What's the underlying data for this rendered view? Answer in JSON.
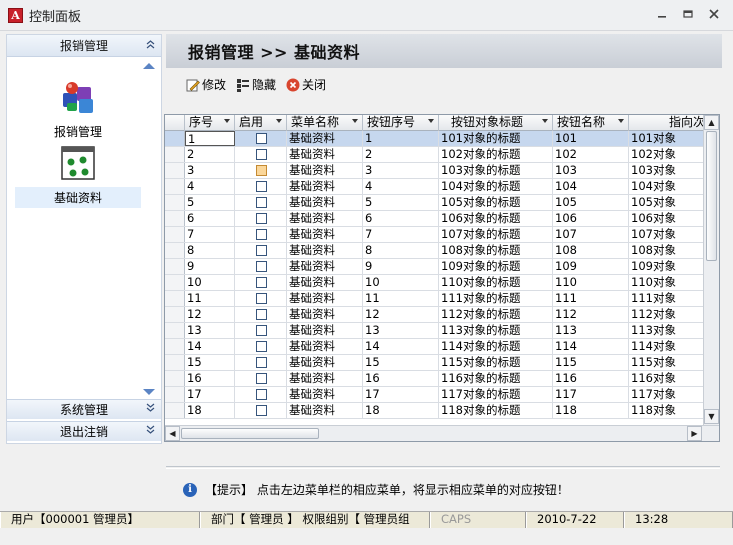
{
  "window": {
    "title": "控制面板",
    "app_icon_letter": "A"
  },
  "sidebar": {
    "header": "报销管理",
    "items": [
      {
        "label": "报销管理",
        "icon": "puzzle-blocks-icon"
      },
      {
        "label": "基础资料",
        "icon": "grid-dots-window-icon"
      }
    ],
    "footers": [
      {
        "label": "系统管理"
      },
      {
        "label": "退出注销"
      }
    ]
  },
  "header": {
    "breadcrumb": "报销管理 >> 基础资料"
  },
  "toolbar": {
    "edit_label": "修改",
    "hide_label": "隐藏",
    "close_label": "关闭"
  },
  "grid": {
    "columns": [
      "序号",
      "启用",
      "菜单名称",
      "按钮序号",
      "按钮对象标题",
      "按钮名称",
      "指向次"
    ],
    "rows": [
      {
        "seq": "1",
        "menu": "基础资料",
        "btn_no": "1",
        "title": "101对象的标题",
        "name": "101",
        "target": "101对象"
      },
      {
        "seq": "2",
        "menu": "基础资料",
        "btn_no": "2",
        "title": "102对象的标题",
        "name": "102",
        "target": "102对象"
      },
      {
        "seq": "3",
        "menu": "基础资料",
        "btn_no": "3",
        "title": "103对象的标题",
        "name": "103",
        "target": "103对象"
      },
      {
        "seq": "4",
        "menu": "基础资料",
        "btn_no": "4",
        "title": "104对象的标题",
        "name": "104",
        "target": "104对象"
      },
      {
        "seq": "5",
        "menu": "基础资料",
        "btn_no": "5",
        "title": "105对象的标题",
        "name": "105",
        "target": "105对象"
      },
      {
        "seq": "6",
        "menu": "基础资料",
        "btn_no": "6",
        "title": "106对象的标题",
        "name": "106",
        "target": "106对象"
      },
      {
        "seq": "7",
        "menu": "基础资料",
        "btn_no": "7",
        "title": "107对象的标题",
        "name": "107",
        "target": "107对象"
      },
      {
        "seq": "8",
        "menu": "基础资料",
        "btn_no": "8",
        "title": "108对象的标题",
        "name": "108",
        "target": "108对象"
      },
      {
        "seq": "9",
        "menu": "基础资料",
        "btn_no": "9",
        "title": "109对象的标题",
        "name": "109",
        "target": "109对象"
      },
      {
        "seq": "10",
        "menu": "基础资料",
        "btn_no": "10",
        "title": "110对象的标题",
        "name": "110",
        "target": "110对象"
      },
      {
        "seq": "11",
        "menu": "基础资料",
        "btn_no": "11",
        "title": "111对象的标题",
        "name": "111",
        "target": "111对象"
      },
      {
        "seq": "12",
        "menu": "基础资料",
        "btn_no": "12",
        "title": "112对象的标题",
        "name": "112",
        "target": "112对象"
      },
      {
        "seq": "13",
        "menu": "基础资料",
        "btn_no": "13",
        "title": "113对象的标题",
        "name": "113",
        "target": "113对象"
      },
      {
        "seq": "14",
        "menu": "基础资料",
        "btn_no": "14",
        "title": "114对象的标题",
        "name": "114",
        "target": "114对象"
      },
      {
        "seq": "15",
        "menu": "基础资料",
        "btn_no": "15",
        "title": "115对象的标题",
        "name": "115",
        "target": "115对象"
      },
      {
        "seq": "16",
        "menu": "基础资料",
        "btn_no": "16",
        "title": "116对象的标题",
        "name": "116",
        "target": "116对象"
      },
      {
        "seq": "17",
        "menu": "基础资料",
        "btn_no": "17",
        "title": "117对象的标题",
        "name": "117",
        "target": "117对象"
      },
      {
        "seq": "18",
        "menu": "基础资料",
        "btn_no": "18",
        "title": "118对象的标题",
        "name": "118",
        "target": "118对象"
      }
    ]
  },
  "hint": {
    "text": "【提示】 点击左边菜单栏的相应菜单，将显示相应菜单的对应按钮！"
  },
  "statusbar": {
    "user": "用户【000001 管理员】",
    "dept": "部门【 管理员 】 权限组别【 管理员组",
    "caps": "CAPS",
    "date": "2010-7-22",
    "time": "13:28"
  },
  "colors": {
    "selected_row": "#c6d7ee",
    "header_band": "#d3d7de",
    "accent_blue": "#2a63b8"
  }
}
